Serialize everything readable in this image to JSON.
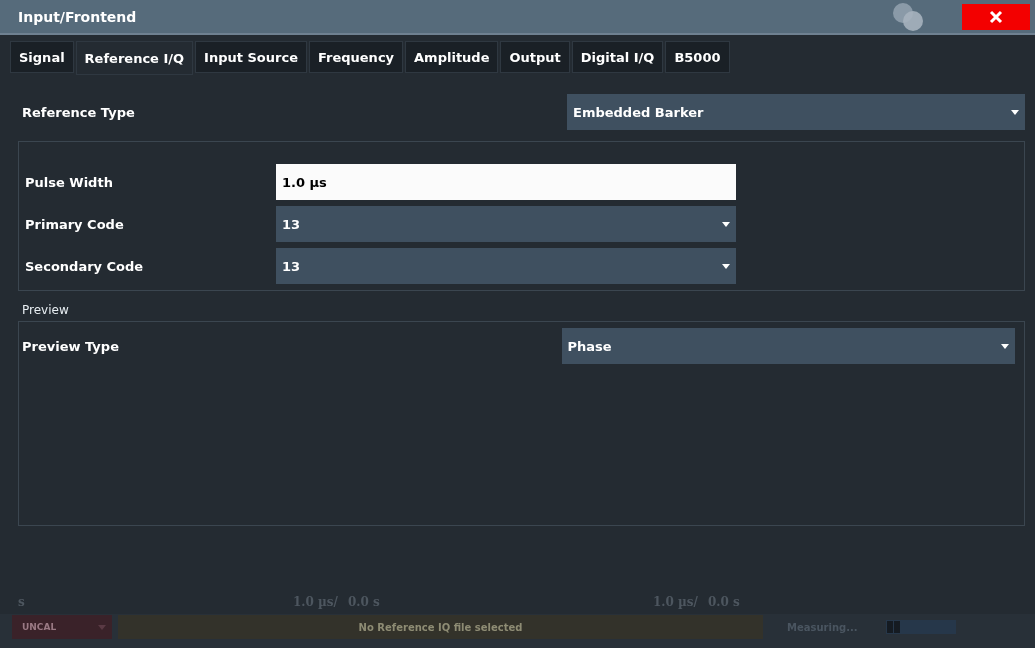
{
  "window": {
    "title": "Input/Frontend"
  },
  "tabs": [
    {
      "label": "Signal",
      "selected": false
    },
    {
      "label": "Reference I/Q",
      "selected": true
    },
    {
      "label": "Input Source",
      "selected": false
    },
    {
      "label": "Frequency",
      "selected": false
    },
    {
      "label": "Amplitude",
      "selected": false
    },
    {
      "label": "Output",
      "selected": false
    },
    {
      "label": "Digital I/Q",
      "selected": false
    },
    {
      "label": "B5000",
      "selected": false
    }
  ],
  "reference_type": {
    "label": "Reference Type",
    "value": "Embedded Barker"
  },
  "settings": [
    {
      "kind": "input",
      "label": "Pulse Width",
      "value": "1.0 µs"
    },
    {
      "kind": "dropdown",
      "label": "Primary Code",
      "value": "13"
    },
    {
      "kind": "dropdown",
      "label": "Secondary Code",
      "value": "13"
    }
  ],
  "preview": {
    "title": "Preview",
    "type_label": "Preview Type",
    "type_value": "Phase"
  },
  "background": {
    "panes": [
      {
        "left": "s",
        "right": "1.0 µs/"
      },
      {
        "left": "0.0 s",
        "right": "1.0 µs/"
      },
      {
        "left": "0.0 s"
      }
    ],
    "status": {
      "uncal": "UNCAL",
      "message": "No Reference IQ file selected",
      "state": "Measuring..."
    }
  }
}
